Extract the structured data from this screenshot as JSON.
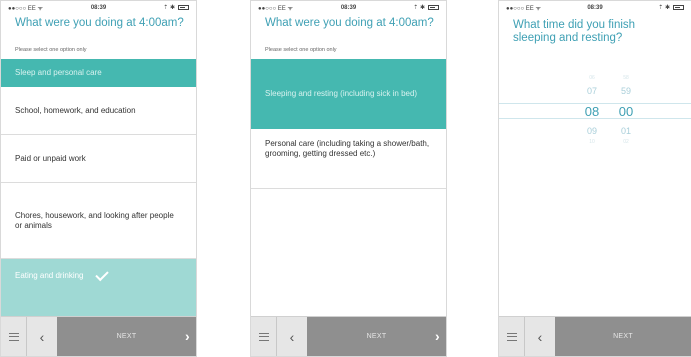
{
  "status": {
    "carrier": "●●○○○ EE ᯤ",
    "time": "08:39",
    "right": "⇡ ✱"
  },
  "screen1": {
    "question": "What were you doing at 4:00am?",
    "hint": "Please select one option only",
    "options": [
      "Sleep and personal care",
      "School, homework, and education",
      "Paid or unpaid work",
      "Chores, housework, and looking after people or animals",
      "Eating and drinking"
    ],
    "next_label": "NEXT"
  },
  "screen2": {
    "question": "What were you doing at 4:00am?",
    "hint": "Please select one option only",
    "options": [
      "Sleeping and resting (including sick in bed)",
      "Personal care (including taking a shower/bath, grooming, getting dressed etc.)"
    ],
    "next_label": "NEXT"
  },
  "screen3": {
    "question": "What time did you finish sleeping and resting?",
    "hours": [
      "06",
      "07",
      "08",
      "09",
      "10"
    ],
    "minutes": [
      "58",
      "59",
      "00",
      "01",
      "02"
    ],
    "next_label": "NEXT"
  },
  "icons": {
    "menu": "hamburger-icon",
    "back": "chevron-left-icon",
    "next": "chevron-right-icon",
    "check": "checkmark-icon"
  },
  "colors": {
    "accent": "#3fa0b4",
    "selected": "#45b8b0",
    "selected_pale": "#9fd9d4",
    "next_bg": "#8f8f8f"
  }
}
